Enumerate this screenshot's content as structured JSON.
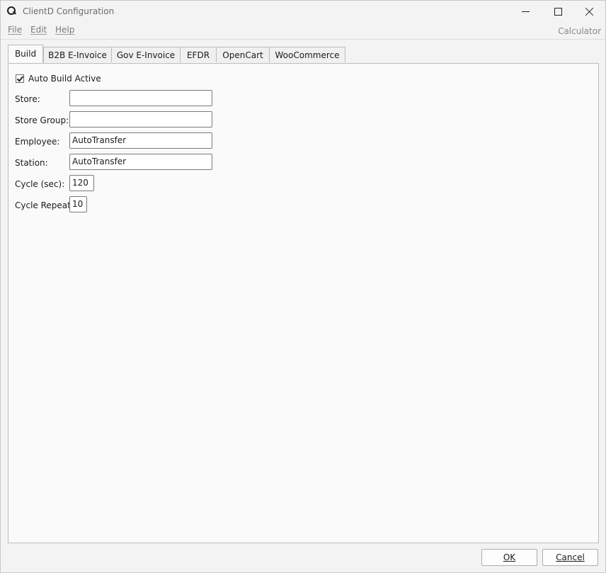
{
  "window": {
    "title": "ClientD Configuration",
    "icon": "app-logo-icon"
  },
  "menubar": {
    "items": [
      {
        "label": "File"
      },
      {
        "label": "Edit"
      },
      {
        "label": "Help"
      }
    ],
    "right_label": "Calculator"
  },
  "tabs": [
    {
      "label": "Build",
      "active": true
    },
    {
      "label": "B2B E-Invoice"
    },
    {
      "label": "Gov E-Invoice"
    },
    {
      "label": "EFDR"
    },
    {
      "label": "OpenCart"
    },
    {
      "label": "WooCommerce"
    }
  ],
  "build": {
    "auto_build": {
      "label": "Auto Build Active",
      "checked": true
    },
    "fields": {
      "store": {
        "label": "Store:",
        "value": ""
      },
      "store_group": {
        "label": "Store Group:",
        "value": ""
      },
      "employee": {
        "label": "Employee:",
        "value": "AutoTransfer"
      },
      "station": {
        "label": "Station:",
        "value": "AutoTransfer"
      },
      "cycle_sec": {
        "label": "Cycle (sec):",
        "value": "120"
      },
      "cycle_repeat": {
        "label": "Cycle Repeat:",
        "value": "10"
      }
    }
  },
  "buttons": {
    "ok": "OK",
    "cancel": "Cancel"
  }
}
